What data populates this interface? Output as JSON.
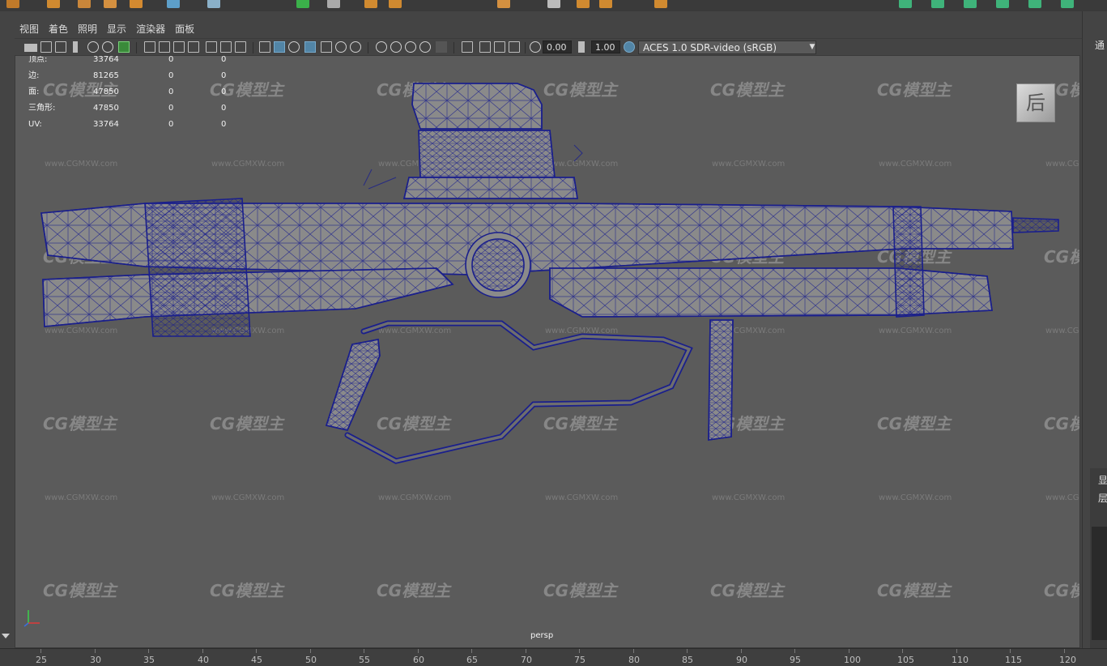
{
  "menu": {
    "items": [
      "视图",
      "着色",
      "照明",
      "显示",
      "渲染器",
      "面板"
    ]
  },
  "toolbar": {
    "exposure_value": "0.00",
    "gamma_value": "1.00",
    "color_space": "ACES 1.0 SDR-video (sRGB)"
  },
  "hud": {
    "rows": [
      {
        "label": "顶点:",
        "v1": "33764",
        "v2": "0",
        "v3": "0"
      },
      {
        "label": "边:",
        "v1": "81265",
        "v2": "0",
        "v3": "0"
      },
      {
        "label": "面:",
        "v1": "47850",
        "v2": "0",
        "v3": "0"
      },
      {
        "label": "三角形:",
        "v1": "47850",
        "v2": "0",
        "v3": "0"
      },
      {
        "label": "UV:",
        "v1": "33764",
        "v2": "0",
        "v3": "0"
      }
    ]
  },
  "view_cube": {
    "label": "后"
  },
  "camera": {
    "name": "persp"
  },
  "watermark": {
    "logo": "CG模型主",
    "url": "www.CGMXW.com"
  },
  "right_panel": {
    "top_label": "通",
    "label_1": "显",
    "label_2": "层"
  },
  "time_ruler": {
    "ticks": [
      "25",
      "30",
      "35",
      "40",
      "45",
      "50",
      "55",
      "60",
      "65",
      "70",
      "75",
      "80",
      "85",
      "90",
      "95",
      "100",
      "105",
      "110",
      "115",
      "120"
    ]
  },
  "colors": {
    "viewport_bg": "#5b5b5b",
    "wireframe": "#1a1f8c",
    "ui_bg": "#444444",
    "accent_blue": "#5285a6"
  }
}
